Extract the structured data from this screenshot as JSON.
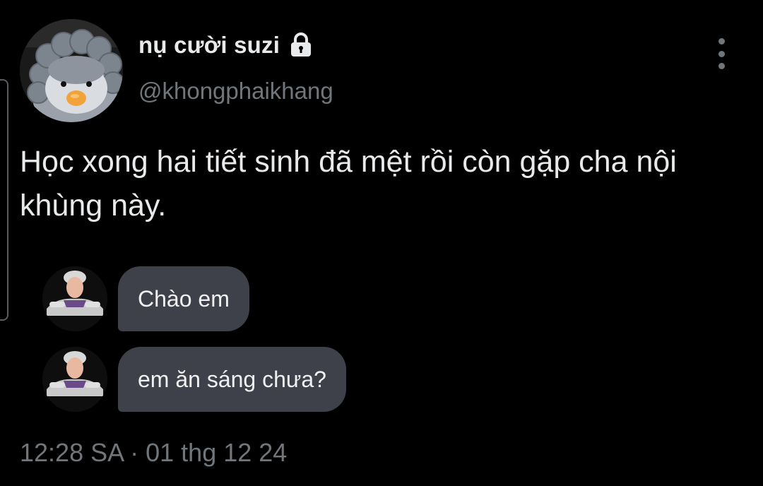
{
  "author": {
    "display_name": "nụ cười suzi",
    "handle": "@khongphaikhang",
    "protected_icon": "lock-icon",
    "avatar": "penguin-plush-avatar"
  },
  "tweet": {
    "text": "Học xong hai tiết sinh đã mệt rồi còn gặp cha nội khùng này.",
    "timestamp": "12:28 SA · 01 thg 12 24"
  },
  "embedded_chat": {
    "messages": [
      {
        "text": "Chào em",
        "avatar": "person-avatar"
      },
      {
        "text": "em ăn sáng chưa?",
        "avatar": "person-avatar"
      }
    ]
  },
  "menu_icon": "more-vertical-icon",
  "colors": {
    "background": "#000000",
    "primary_text": "#e7e9ea",
    "secondary_text": "#71767b",
    "bubble": "#3e4149"
  }
}
